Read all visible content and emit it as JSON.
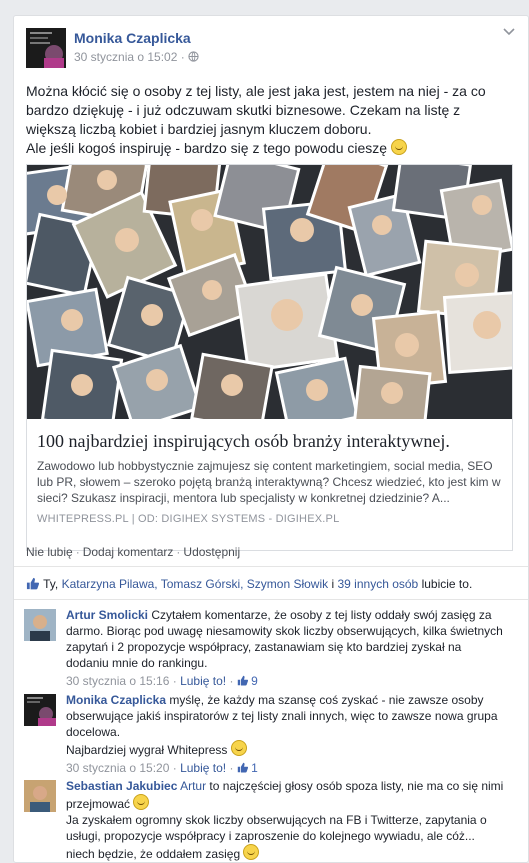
{
  "post": {
    "author": "Monika Czaplicka",
    "timestamp": "30 stycznia o 15:02",
    "privacy_icon": "globe-icon",
    "text_line1": "Można kłócić się o osoby z tej listy, ale jest jaka jest, jestem na niej - za co bardzo dziękuję - i już odczuwam skutki biznesowe. Czekam na listę z większą liczbą kobiet i bardziej jasnym kluczem doboru.",
    "text_line2": "Ale jeśli kogoś inspiruję - bardzo się z tego powodu cieszę"
  },
  "link": {
    "title": "100 najbardziej inspirujących osób branży interaktywnej.",
    "description": "Zawodowo lub hobbystycznie zajmujesz się content marketingiem, social media, SEO lub PR, słowem – szeroko pojętą branżą interaktywną? Chcesz wiedzieć, kto jest kim w sieci? Szukasz inspiracji, mentora lub specjalisty w konkretnej dziedzinie? A...",
    "source": "WHITEPRESS.PL | OD: DIGIHEX SYSTEMS - DIGIHEX.PL"
  },
  "actions": {
    "unlike": "Nie lubię",
    "comment": "Dodaj komentarz",
    "share": "Udostępnij"
  },
  "likes": {
    "prefix": "Ty,",
    "names": "Katarzyna Pilawa, Tomasz Górski, Szymon Słowik",
    "connector": "i",
    "others": "39 innych osób",
    "suffix": "lubicie to."
  },
  "comments": [
    {
      "author": "Artur Smolicki",
      "text": "Czytałem komentarze, że osoby z tej listy oddały swój zasięg za darmo. Biorąc pod uwagę niesamowity skok liczby obserwujących, kilka świetnych zapytań i 2 propozycje współpracy, zastanawiam się kto bardziej zyskał na dodaniu mnie do rankingu.",
      "time": "30 stycznia o 15:16",
      "like_label": "Lubię to!",
      "like_count": "9"
    },
    {
      "author": "Monika Czaplicka",
      "text": "myślę, że każdy ma szansę coś zyskać - nie zawsze osoby obserwujące jakiś inspiratorów z tej listy znali innych, więc to zawsze nowa grupa docelowa.",
      "text2": "Najbardziej wygrał Whitepress",
      "time": "30 stycznia o 15:20",
      "like_label": "Lubię to!",
      "like_count": "1"
    },
    {
      "author": "Sebastian Jakubiec",
      "mention": "Artur",
      "text": "to najczęściej głosy osób spoza listy, nie ma co się nimi przejmować",
      "text2": "Ja zyskałem ogromny skok liczby obserwujących na FB i Twitterze, zapytania o usługi, propozycje współpracy i zaproszenie do kolejnego wywiadu, ale cóż... niech będzie, że oddałem zasięg"
    }
  ],
  "colors": {
    "link": "#365899",
    "muted": "#90949c",
    "background": "#e9ebee"
  }
}
